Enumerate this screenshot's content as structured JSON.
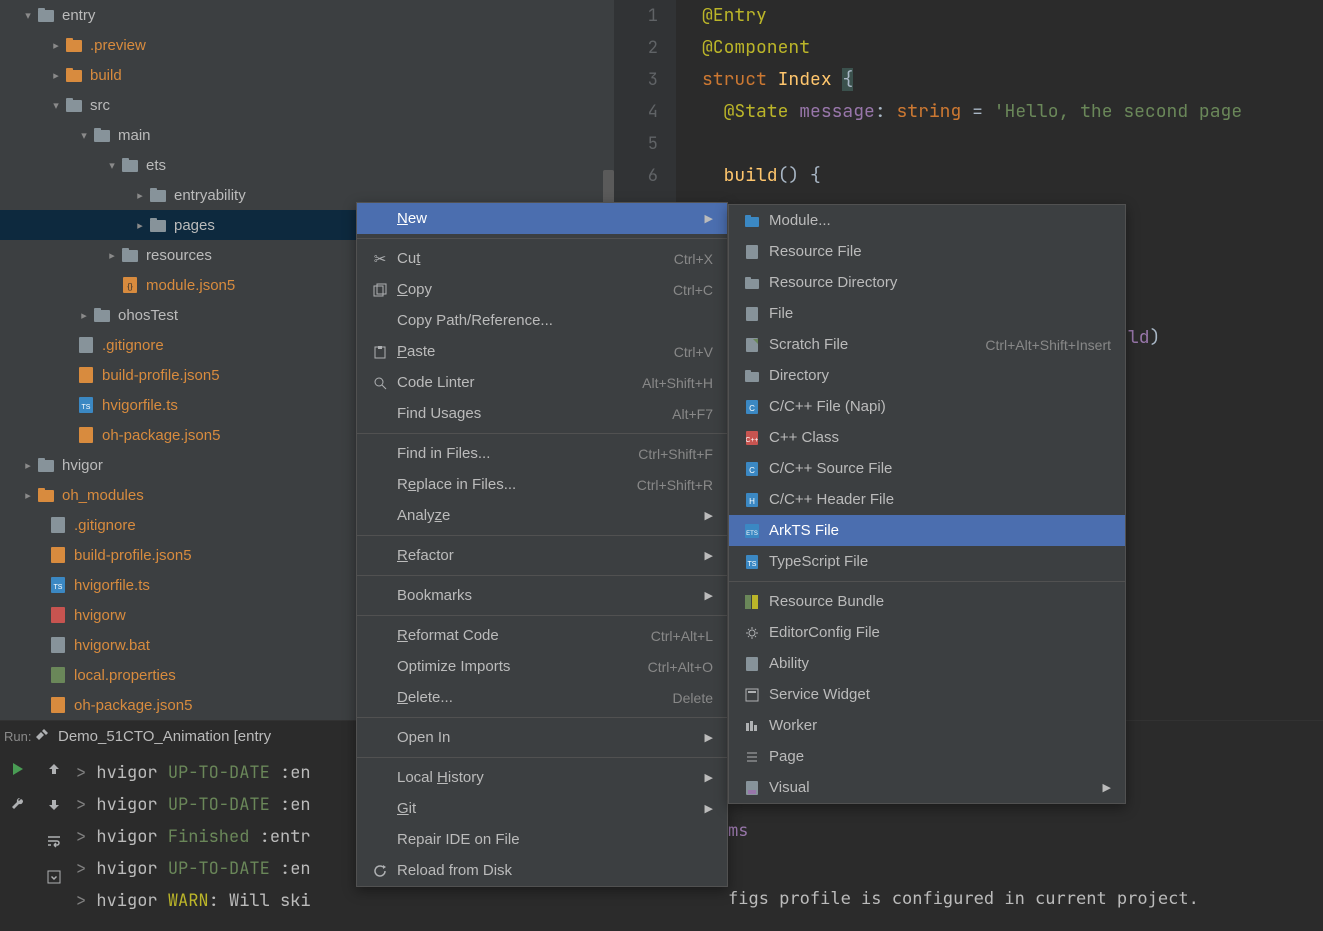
{
  "tree": {
    "entry": "entry",
    "preview": ".preview",
    "build": "build",
    "src": "src",
    "main": "main",
    "ets": "ets",
    "entryability": "entryability",
    "pages": "pages",
    "resources": "resources",
    "module_json": "module.json5",
    "ohosTest": "ohosTest",
    "gitignore1": ".gitignore",
    "build_profile1": "build-profile.json5",
    "hvigorfile1": "hvigorfile.ts",
    "oh_package1": "oh-package.json5",
    "hvigor": "hvigor",
    "oh_modules": "oh_modules",
    "gitignore2": ".gitignore",
    "build_profile2": "build-profile.json5",
    "hvigorfile2": "hvigorfile.ts",
    "hvigorw": "hvigorw",
    "hvigorw_bat": "hvigorw.bat",
    "local_props": "local.properties",
    "oh_package2": "oh-package.json5"
  },
  "code": {
    "l1_entry": "@Entry",
    "l2_component": "@Component",
    "l3_struct": "struct",
    "l3_index": "Index",
    "l3_brace": "{",
    "l4_state": "@State",
    "l4_msg": "message",
    "l4_colon": ":",
    "l4_string": "string",
    "l4_eq": "=",
    "l4_literal": "'Hello, the second page",
    "l6_build": "build",
    "l6_paren": "()",
    "l6_brace": "{",
    "frag_ld": "ld",
    "frag_paren": ")",
    "frag_ms": "ms",
    "frag_tail": "figs profile is configured in current project."
  },
  "gutter": [
    "1",
    "2",
    "3",
    "4",
    "5",
    "6"
  ],
  "run": {
    "title_prefix": "Run:",
    "config": "Demo_51CTO_Animation [entry",
    "lines": [
      {
        "prefix": "> ",
        "task": "hvigor ",
        "status": "UP-TO-DATE",
        "rest": " :en"
      },
      {
        "prefix": "> ",
        "task": "hvigor ",
        "status": "UP-TO-DATE",
        "rest": " :en"
      },
      {
        "prefix": "> ",
        "task": "hvigor ",
        "status": "Finished",
        "rest": " :entr"
      },
      {
        "prefix": "> ",
        "task": "hvigor ",
        "status": "UP-TO-DATE",
        "rest": " :en"
      },
      {
        "prefix": "> ",
        "task": "hvigor ",
        "status": "WARN",
        "statusClass": "warn",
        "rest": ": Will ski"
      }
    ]
  },
  "menu1": {
    "new": "New",
    "cut": "Cut",
    "cut_s": "Ctrl+X",
    "copy": "Copy",
    "copy_s": "Ctrl+C",
    "copypath": "Copy Path/Reference...",
    "paste": "Paste",
    "paste_s": "Ctrl+V",
    "codelinter": "Code Linter",
    "codelinter_s": "Alt+Shift+H",
    "findusages": "Find Usages",
    "findusages_s": "Alt+F7",
    "findinfiles": "Find in Files...",
    "findinfiles_s": "Ctrl+Shift+F",
    "replaceinfiles": "Replace in Files...",
    "replaceinfiles_s": "Ctrl+Shift+R",
    "analyze": "Analyze",
    "refactor": "Refactor",
    "bookmarks": "Bookmarks",
    "reformat": "Reformat Code",
    "reformat_s": "Ctrl+Alt+L",
    "optimize": "Optimize Imports",
    "optimize_s": "Ctrl+Alt+O",
    "delete": "Delete...",
    "delete_s": "Delete",
    "openin": "Open In",
    "localhistory": "Local History",
    "git": "Git",
    "repairide": "Repair IDE on File",
    "reload": "Reload from Disk"
  },
  "menu2": {
    "module": "Module...",
    "resourcefile": "Resource File",
    "resourcedir": "Resource Directory",
    "file": "File",
    "scratch": "Scratch File",
    "scratch_s": "Ctrl+Alt+Shift+Insert",
    "directory": "Directory",
    "ccppnapi": "C/C++ File (Napi)",
    "cppclass": "C++ Class",
    "ccppsource": "C/C++ Source File",
    "ccppheader": "C/C++ Header File",
    "arkts": "ArkTS File",
    "typescript": "TypeScript File",
    "resourcebundle": "Resource Bundle",
    "editorconfig": "EditorConfig File",
    "ability": "Ability",
    "servicewidget": "Service Widget",
    "worker": "Worker",
    "page": "Page",
    "visual": "Visual"
  }
}
